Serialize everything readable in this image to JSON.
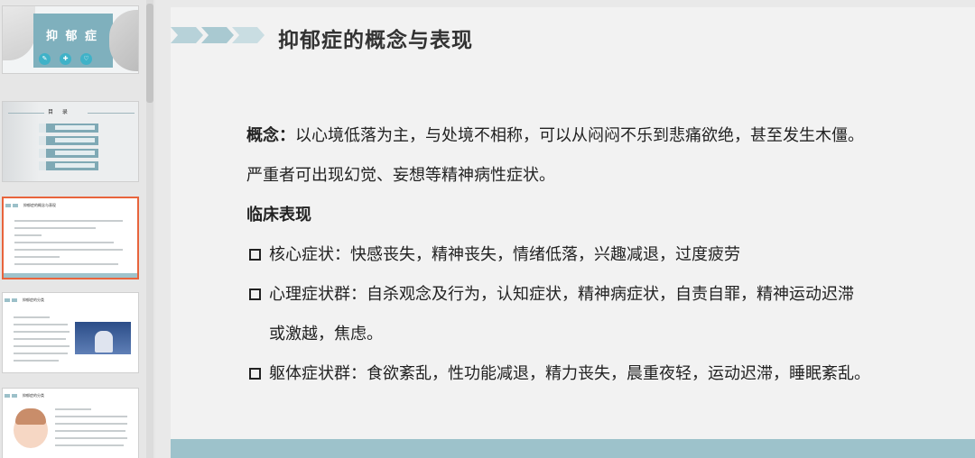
{
  "thumbnails": [
    {
      "title": "抑 郁 症",
      "icons": [
        "syringe-icon",
        "first-aid-icon",
        "stethoscope-icon"
      ]
    },
    {
      "title": "目 录"
    },
    {
      "title": "抑郁症的概念与表现",
      "active": true
    },
    {
      "title": "抑郁症的分类"
    },
    {
      "title": "抑郁症的分类"
    }
  ],
  "slide": {
    "title": "抑郁症的概念与表现",
    "concept_label": "概念：",
    "concept_text": "以心境低落为主，与处境不相称，可以从闷闷不乐到悲痛欲绝，甚至发生木僵。",
    "concept_text2": "严重者可出现幻觉、妄想等精神病性症状。",
    "clinical_heading": "临床表现",
    "bullets": [
      {
        "line1": "核心症状：快感丧失，精神丧失，情绪低落，兴趣减退，过度疲劳",
        "line2": ""
      },
      {
        "line1": "心理症状群：自杀观念及行为，认知症状，精神病症状，自责自罪，精神运动迟滞",
        "line2": "或激越，焦虑。"
      },
      {
        "line1": "躯体症状群：食欲紊乱，性功能减退，精力丧失，晨重夜轻，运动迟滞，睡眠紊乱。",
        "line2": ""
      }
    ]
  },
  "colors": {
    "accent": "#9dc2cb",
    "active_border": "#e8643c",
    "chevron": "#9cc0c9"
  }
}
